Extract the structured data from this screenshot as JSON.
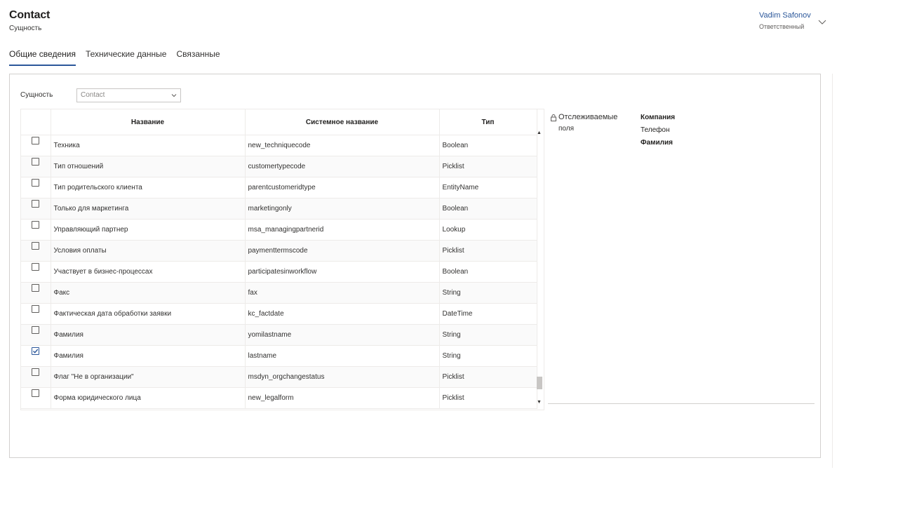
{
  "header": {
    "title": "Contact",
    "subtitle": "Сущность",
    "owner_name": "Vadim Safonov",
    "owner_role": "Ответственный"
  },
  "tabs": [
    {
      "label": "Общие сведения"
    },
    {
      "label": "Технические данные"
    },
    {
      "label": "Связанные"
    }
  ],
  "form": {
    "entity_label": "Сущность",
    "entity_value": "Contact"
  },
  "grid": {
    "columns": [
      "Название",
      "Системное название",
      "Тип"
    ],
    "rows": [
      {
        "name": "Техника",
        "system": "new_techniquecode",
        "type": "Boolean",
        "checked": false
      },
      {
        "name": "Тип отношений",
        "system": "customertypecode",
        "type": "Picklist",
        "checked": false
      },
      {
        "name": "Тип родительского клиента",
        "system": "parentcustomeridtype",
        "type": "EntityName",
        "checked": false
      },
      {
        "name": "Только для маркетинга",
        "system": "marketingonly",
        "type": "Boolean",
        "checked": false
      },
      {
        "name": "Управляющий партнер",
        "system": "msa_managingpartnerid",
        "type": "Lookup",
        "checked": false
      },
      {
        "name": "Условия оплаты",
        "system": "paymenttermscode",
        "type": "Picklist",
        "checked": false
      },
      {
        "name": "Участвует в бизнес-процессах",
        "system": "participatesinworkflow",
        "type": "Boolean",
        "checked": false
      },
      {
        "name": "Факс",
        "system": "fax",
        "type": "String",
        "checked": false
      },
      {
        "name": "Фактическая дата обработки заявки",
        "system": "kc_factdate",
        "type": "DateTime",
        "checked": false
      },
      {
        "name": "Фамилия",
        "system": "yomilastname",
        "type": "String",
        "checked": false
      },
      {
        "name": "Фамилия",
        "system": "lastname",
        "type": "String",
        "checked": true
      },
      {
        "name": "Флаг \"Не в организации\"",
        "system": "msdyn_orgchangestatus",
        "type": "Picklist",
        "checked": false
      },
      {
        "name": "Форма юридического лица",
        "system": "new_legalform",
        "type": "Picklist",
        "checked": false
      }
    ]
  },
  "tracked": {
    "label_line1": "Отслеживаемые",
    "label_line2": "поля",
    "fields": [
      "Компания",
      "Телефон",
      "Фамилия"
    ]
  }
}
